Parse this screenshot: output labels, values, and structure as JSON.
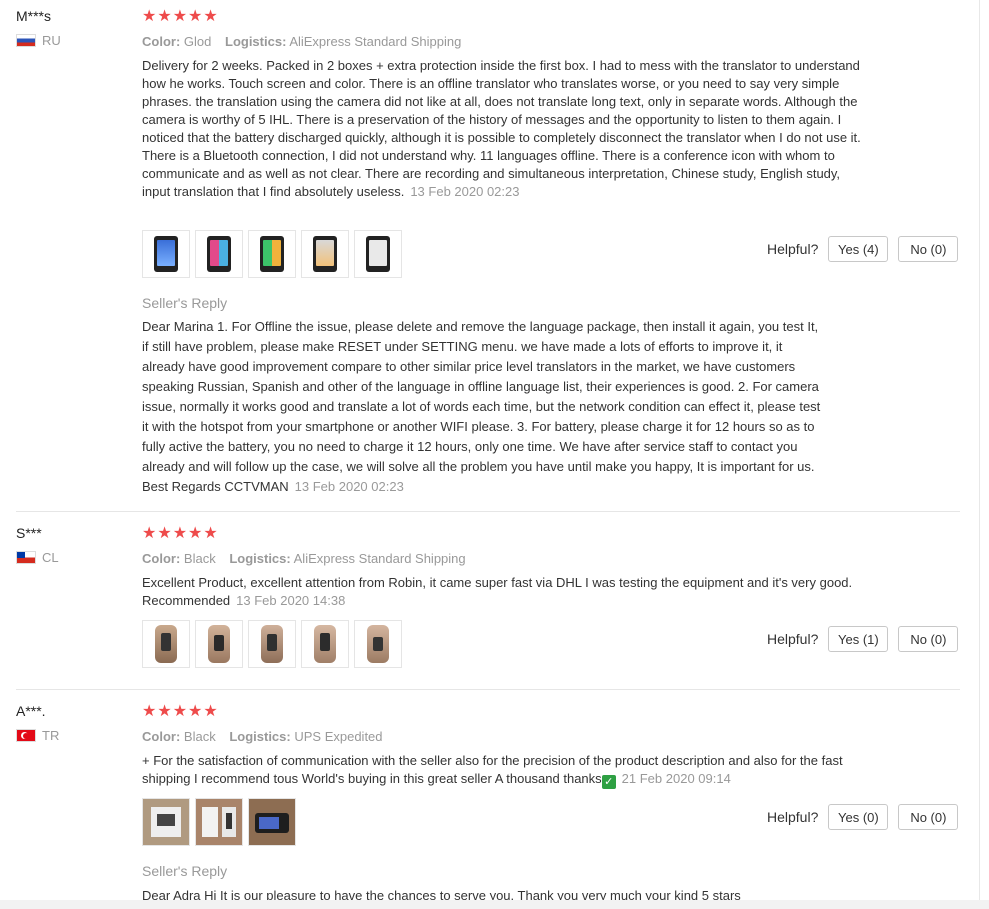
{
  "helpful_label": "Helpful?",
  "labels": {
    "color": "Color:",
    "logistics": "Logistics:",
    "seller_reply": "Seller's Reply"
  },
  "rating_stars": "★★★★★",
  "reviews": [
    {
      "user": "M***s",
      "country": "RU",
      "color": "Glod",
      "logistics": "AliExpress Standard Shipping",
      "text": "Delivery for 2 weeks. Packed in 2 boxes + extra protection inside the first box. I had to mess with the translator to understand how he works. Touch screen and color. There is an offline translator who translates worse, or you need to say very simple phrases. the translation using the camera did not like at all, does not translate long text, only in separate words. Although the camera is worthy of 5 IHL. There is a preservation of the history of messages and the opportunity to listen to them again. I noticed that the battery discharged quickly, although it is possible to completely disconnect the translator when I do not use it. There is a Bluetooth connection, I did not understand why. 11 languages offline. There is a conference icon with whom to communicate and as well as not clear. There are recording and simultaneous interpretation, Chinese study, English study, input translation that I find absolutely useless.",
      "date": "13 Feb 2020 02:23",
      "yes": "Yes (4)",
      "no": "No (0)",
      "reply": "Dear Marina 1. For Offline the issue, please delete and remove the language package, then install it again, you test It, if still have problem, please make RESET under SETTING menu. we have made a lots of efforts to improve it, it already have good improvement compare to other similar price level translators in the market, we have customers speaking Russian, Spanish and other of the language in offline language list, their experiences is good. 2. For camera issue, normally it works good and translate a lot of words each time, but the network condition can effect it, please test it with the hotspot from your smartphone or another WIFI please. 3. For battery, please charge it for 12 hours so as to fully active the battery, you no need to charge it 12 hours, only one time. We have after service staff to contact you already and will follow up the case, we will solve all the problem you have until make you happy, It is important for us. Best Regards CCTVMAN",
      "reply_date": "13 Feb 2020 02:23"
    },
    {
      "user": "S***",
      "country": "CL",
      "color": "Black",
      "logistics": "AliExpress Standard Shipping",
      "text": "Excellent Product, excellent attention from Robin, it came super fast via DHL I was testing the equipment and it's very good. Recommended",
      "date": "13 Feb 2020 14:38",
      "yes": "Yes (1)",
      "no": "No (0)"
    },
    {
      "user": "A***.",
      "country": "TR",
      "color": "Black",
      "logistics": "UPS Expedited",
      "text": "+ For the satisfaction of communication with the seller also for the precision of the product description and also for the fast shipping I recommend tous World's buying in this great seller A thousand thanks",
      "date": "21 Feb 2020 09:14",
      "yes": "Yes (0)",
      "no": "No (0)",
      "reply": "Dear Adra Hi It is our pleasure to have the chances to serve you. Thank you very much your kind 5 stars"
    }
  ]
}
